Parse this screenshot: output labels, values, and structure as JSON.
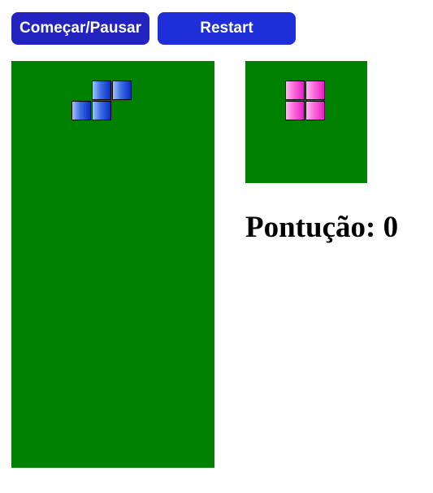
{
  "controls": {
    "start_pause_label": "Começar/Pausar",
    "restart_label": "Restart"
  },
  "score": {
    "label": "Pontução:",
    "value": "0"
  },
  "game": {
    "board": {
      "columns": 10,
      "rows": 20,
      "background": "#008000"
    },
    "current_piece": {
      "shape": "S",
      "color": "blue",
      "cells": [
        [
          4,
          1
        ],
        [
          5,
          1
        ],
        [
          3,
          2
        ],
        [
          4,
          2
        ]
      ]
    },
    "next_piece": {
      "shape": "O",
      "color": "pink",
      "cells": [
        [
          2,
          1
        ],
        [
          3,
          1
        ],
        [
          2,
          2
        ],
        [
          3,
          2
        ]
      ]
    }
  },
  "colors": {
    "button_start": "#2323c0",
    "button_restart": "#1e2ed8",
    "board": "#008000",
    "blue_piece": "#0a2fc5",
    "pink_piece": "#ff66dc"
  }
}
